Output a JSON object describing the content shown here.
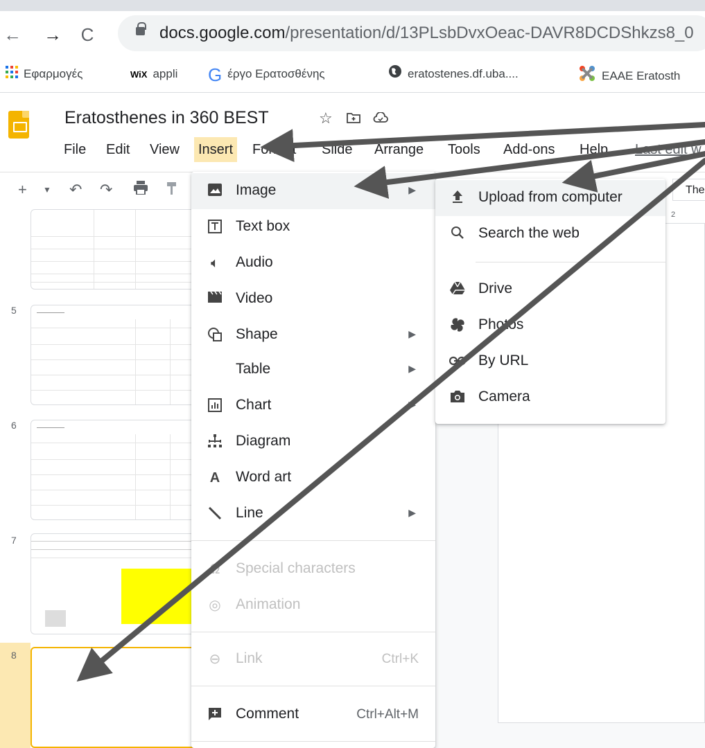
{
  "browser": {
    "url_domain": "docs.google.com",
    "url_path": "/presentation/d/13PLsbDvxOeac-DAVR8DCDShkzs8_0",
    "bookmarks": [
      {
        "label": "Εφαρμογές",
        "icon": "apps-grid-icon"
      },
      {
        "label": "appli",
        "icon": "wix-icon",
        "badge": "WiX"
      },
      {
        "label": "έργο Ερατοσθένης",
        "icon": "google-icon",
        "badge": "G"
      },
      {
        "label": "eratostenes.df.uba....",
        "icon": "globe-icon"
      },
      {
        "label": "EAAE Eratosth",
        "icon": "joomla-icon"
      }
    ]
  },
  "doc": {
    "title": "Eratosthenes in 360 BEST",
    "menus": [
      "File",
      "Edit",
      "View",
      "Insert",
      "Format",
      "Slide",
      "Arrange",
      "Tools",
      "Add-ons",
      "Help",
      "Last edit w"
    ]
  },
  "theme_button": "The",
  "ruler_mark": "2",
  "slides": [
    {
      "number": ""
    },
    {
      "number": "5"
    },
    {
      "number": "6"
    },
    {
      "number": "7"
    },
    {
      "number": "8"
    }
  ],
  "insert_menu": {
    "items": [
      {
        "label": "Image",
        "icon": "image-icon",
        "has_submenu": true,
        "disabled": false,
        "shortcut": ""
      },
      {
        "label": "Text box",
        "icon": "text-box-icon",
        "has_submenu": false,
        "disabled": false,
        "shortcut": ""
      },
      {
        "label": "Audio",
        "icon": "audio-icon",
        "has_submenu": false,
        "disabled": false,
        "shortcut": ""
      },
      {
        "label": "Video",
        "icon": "video-icon",
        "has_submenu": false,
        "disabled": false,
        "shortcut": ""
      },
      {
        "label": "Shape",
        "icon": "shape-icon",
        "has_submenu": true,
        "disabled": false,
        "shortcut": ""
      },
      {
        "label": "Table",
        "icon": "",
        "has_submenu": true,
        "disabled": false,
        "shortcut": ""
      },
      {
        "label": "Chart",
        "icon": "chart-icon",
        "has_submenu": true,
        "disabled": false,
        "shortcut": ""
      },
      {
        "label": "Diagram",
        "icon": "diagram-icon",
        "has_submenu": false,
        "disabled": false,
        "shortcut": ""
      },
      {
        "label": "Word art",
        "icon": "word-art-icon",
        "has_submenu": false,
        "disabled": false,
        "shortcut": ""
      },
      {
        "label": "Line",
        "icon": "line-icon",
        "has_submenu": true,
        "disabled": false,
        "shortcut": ""
      },
      {
        "label": "Special characters",
        "icon": "special-characters-icon",
        "has_submenu": false,
        "disabled": true,
        "shortcut": ""
      },
      {
        "label": "Animation",
        "icon": "animation-icon",
        "has_submenu": false,
        "disabled": true,
        "shortcut": ""
      },
      {
        "label": "Link",
        "icon": "link-icon",
        "has_submenu": false,
        "disabled": true,
        "shortcut": "Ctrl+K"
      },
      {
        "label": "Comment",
        "icon": "comment-icon",
        "has_submenu": false,
        "disabled": false,
        "shortcut": "Ctrl+Alt+M"
      }
    ]
  },
  "image_submenu": {
    "items": [
      {
        "label": "Upload from computer",
        "icon": "upload-icon"
      },
      {
        "label": "Search the web",
        "icon": "search-icon"
      },
      {
        "label": "Drive",
        "icon": "drive-icon"
      },
      {
        "label": "Photos",
        "icon": "photos-icon"
      },
      {
        "label": "By URL",
        "icon": "link-icon"
      },
      {
        "label": "Camera",
        "icon": "camera-icon"
      }
    ]
  },
  "colors": {
    "accent_yellow": "#f4b400",
    "menu_highlight": "#fce8b2",
    "arrow_gray": "#555555"
  }
}
